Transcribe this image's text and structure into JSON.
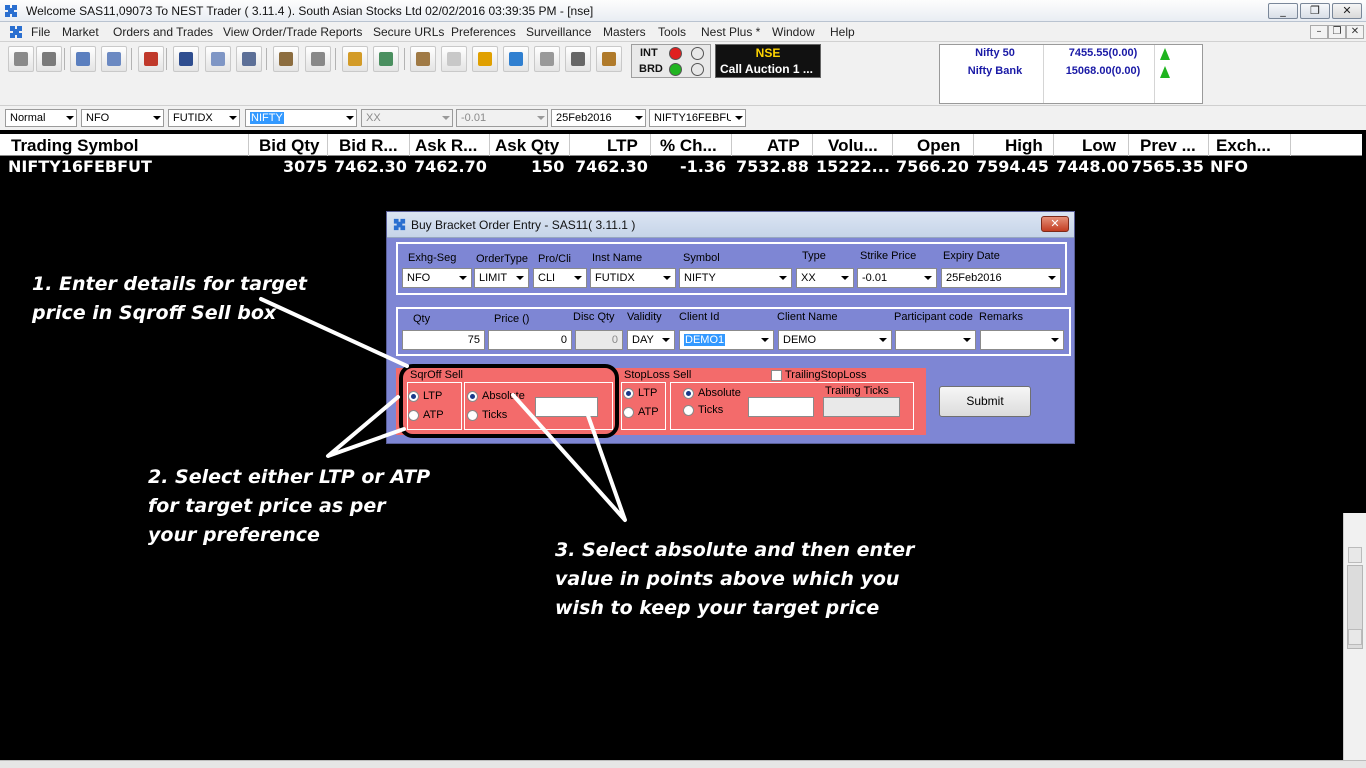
{
  "window": {
    "title": "Welcome SAS11,09073 To NEST Trader ( 3.11.4 ).  South Asian Stocks Ltd  02/02/2016  03:39:35 PM - [nse]",
    "min": "_",
    "restore": "❐",
    "close": "✕"
  },
  "menu": [
    "File",
    "Market",
    "Orders and Trades",
    "View Order/Trade Reports",
    "Secure URLs",
    "Preferences",
    "Surveillance",
    "Masters",
    "Tools",
    "Nest Plus *",
    "Window",
    "Help"
  ],
  "mdi": {
    "min": "–",
    "restore": "❐",
    "close": "✕"
  },
  "toolbar": {
    "int": "INT",
    "brd": "BRD",
    "exchange": "NSE",
    "session": "Call Auction 1 ..."
  },
  "indices": [
    {
      "name": "Nifty 50",
      "value": "7455.55(0.00)"
    },
    {
      "name": "Nifty Bank",
      "value": "15068.00(0.00)"
    }
  ],
  "selectors": [
    "Normal",
    "NFO",
    "FUTIDX",
    "NIFTY",
    "XX",
    "-0.01",
    "25Feb2016",
    "NIFTY16FEBFU"
  ],
  "market_watch": {
    "columns": [
      "Trading Symbol",
      "Bid Qty",
      "Bid R...",
      "Ask R...",
      "Ask Qty",
      "LTP",
      "% Ch...",
      "ATP",
      "Volu...",
      "Open",
      "High",
      "Low",
      "Prev ...",
      "Exch..."
    ],
    "row": [
      "NIFTY16FEBFUT",
      "3075",
      "7462.30",
      "7462.70",
      "150",
      "7462.30",
      "-1.36",
      "7532.88",
      "15222...",
      "7566.20",
      "7594.45",
      "7448.00",
      "7565.35",
      "NFO"
    ]
  },
  "dialog": {
    "title": "Buy Bracket Order Entry - SAS11( 3.11.1 )",
    "close": "✕",
    "labels": {
      "exch_seg": "Exhg-Seg",
      "order_type": "OrderType",
      "pro_cli": "Pro/Cli",
      "inst_name": "Inst Name",
      "symbol": "Symbol",
      "type": "Type",
      "strike": "Strike Price",
      "expiry": "Expiry Date",
      "qty": "Qty",
      "price": "Price ()",
      "disc_qty": "Disc Qty",
      "validity": "Validity",
      "client_id": "Client Id",
      "client_name": "Client Name",
      "participant": "Participant code",
      "remarks": "Remarks"
    },
    "values": {
      "exch_seg": "NFO",
      "order_type": "LIMIT",
      "pro_cli": "CLI",
      "inst_name": "FUTIDX",
      "symbol": "NIFTY",
      "type": "XX",
      "strike": "-0.01",
      "expiry": "25Feb2016",
      "qty": "75",
      "price": "0",
      "disc_qty": "0",
      "validity": "DAY",
      "client_id": "DEMO1",
      "client_name": "DEMO"
    },
    "sqroff": {
      "title": "SqrOff Sell",
      "ltp": "LTP",
      "atp": "ATP",
      "absolute": "Absolute",
      "ticks": "Ticks"
    },
    "stoploss": {
      "title": "StopLoss Sell",
      "ltp": "LTP",
      "atp": "ATP",
      "absolute": "Absolute",
      "ticks": "Ticks",
      "trailing": "TrailingStopLoss",
      "trailing_ticks": "Trailing Ticks"
    },
    "submit": "Submit"
  },
  "annotations": {
    "note1": [
      "1. Enter details for target",
      "price in Sqroff Sell box"
    ],
    "note2": [
      "2. Select either LTP or ATP",
      "for target price as per",
      "your preference"
    ],
    "note3": [
      "3. Select absolute and then enter",
      "value in points above which you",
      "wish to keep your target price"
    ]
  },
  "colors": {
    "dialog_bg": "#7e86d4",
    "sqroff_bg": "#f36b6b",
    "index_text": "#1a1aa6",
    "up_arrow": "#1fb41f",
    "exchange_text": "#ffd400"
  }
}
